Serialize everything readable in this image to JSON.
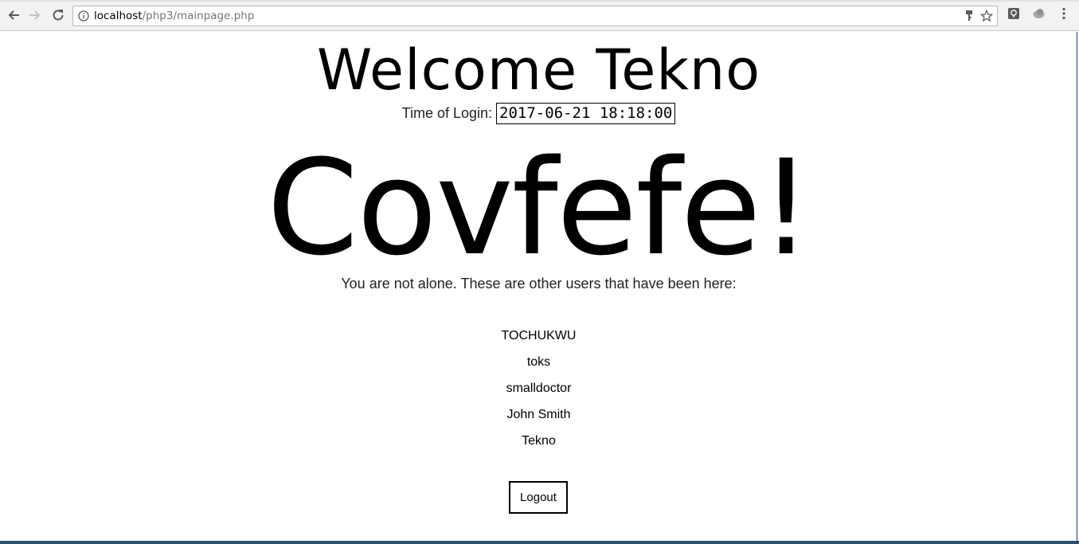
{
  "browser": {
    "url_host": "localhost",
    "url_path": "/php3/mainpage.php"
  },
  "page": {
    "welcome": "Welcome Tekno",
    "login_label": "Time of Login:",
    "login_time": "2017-06-21 18:18:00",
    "brand": "Covfefe!",
    "intro": "You are not alone. These are other users that have been here:",
    "users": [
      "TOCHUKWU",
      "toks",
      "smalldoctor",
      "John Smith",
      "Tekno"
    ],
    "logout_label": "Logout"
  }
}
